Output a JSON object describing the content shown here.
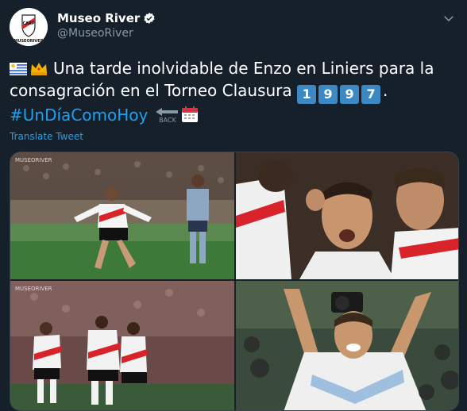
{
  "account": {
    "name": "Museo River",
    "handle": "@MuseoRiver",
    "avatar_text": "MUSEORIVER",
    "verified_icon": "verified-badge-icon"
  },
  "tweet": {
    "text_main": "Una tarde inolvidable de Enzo en Liniers para la consagración en el Torneo Clausura",
    "year_digits": [
      "1",
      "9",
      "9",
      "7"
    ],
    "text_end": ".",
    "hashtag": "#UnDíaComoHoy",
    "back_label": "BACK",
    "emojis": [
      "uruguay-flag-icon",
      "crown-icon",
      "back-arrow-icon",
      "calendar-icon"
    ]
  },
  "translate_label": "Translate Tweet",
  "photos": [
    {
      "name": "photo-celebration-running",
      "watermark": "MUSEORIVER"
    },
    {
      "name": "photo-teammates-celebrating",
      "watermark": ""
    },
    {
      "name": "photo-team-hug",
      "watermark": "MUSEORIVER"
    },
    {
      "name": "photo-arms-raised",
      "watermark": ""
    }
  ],
  "colors": {
    "background": "#15202b",
    "link": "#1da1f2",
    "secondary_text": "#8899a6",
    "river_red": "#d8232a"
  }
}
